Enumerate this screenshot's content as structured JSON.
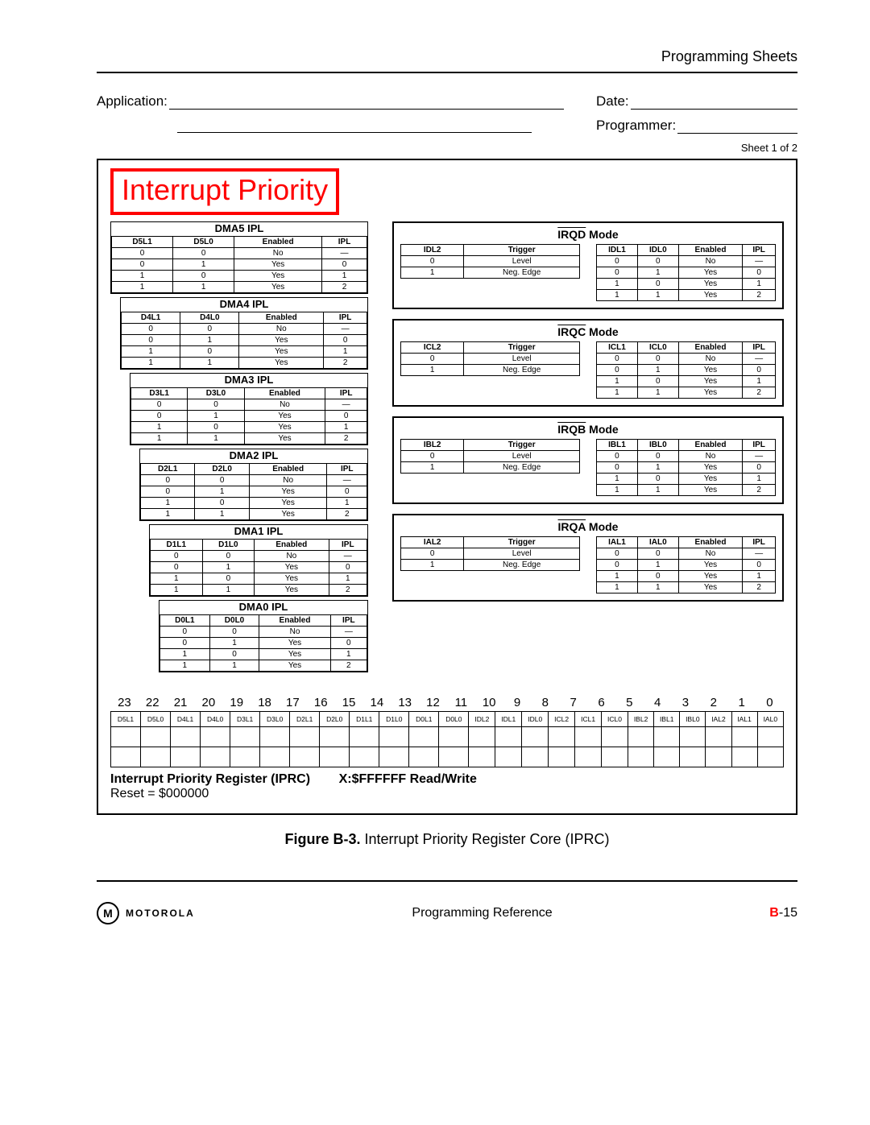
{
  "header": {
    "section": "Programming Sheets"
  },
  "form": {
    "application_label": "Application:",
    "date_label": "Date:",
    "programmer_label": "Programmer:",
    "sheet_info": "Sheet 1 of 2"
  },
  "title": "Interrupt Priority",
  "dma_tables": [
    {
      "caption": "DMA5 IPL",
      "headers": [
        "D5L1",
        "D5L0",
        "Enabled",
        "IPL"
      ],
      "rows": [
        [
          "0",
          "0",
          "No",
          "—"
        ],
        [
          "0",
          "1",
          "Yes",
          "0"
        ],
        [
          "1",
          "0",
          "Yes",
          "1"
        ],
        [
          "1",
          "1",
          "Yes",
          "2"
        ]
      ]
    },
    {
      "caption": "DMA4 IPL",
      "headers": [
        "D4L1",
        "D4L0",
        "Enabled",
        "IPL"
      ],
      "rows": [
        [
          "0",
          "0",
          "No",
          "—"
        ],
        [
          "0",
          "1",
          "Yes",
          "0"
        ],
        [
          "1",
          "0",
          "Yes",
          "1"
        ],
        [
          "1",
          "1",
          "Yes",
          "2"
        ]
      ]
    },
    {
      "caption": "DMA3 IPL",
      "headers": [
        "D3L1",
        "D3L0",
        "Enabled",
        "IPL"
      ],
      "rows": [
        [
          "0",
          "0",
          "No",
          "—"
        ],
        [
          "0",
          "1",
          "Yes",
          "0"
        ],
        [
          "1",
          "0",
          "Yes",
          "1"
        ],
        [
          "1",
          "1",
          "Yes",
          "2"
        ]
      ]
    },
    {
      "caption": "DMA2 IPL",
      "headers": [
        "D2L1",
        "D2L0",
        "Enabled",
        "IPL"
      ],
      "rows": [
        [
          "0",
          "0",
          "No",
          "—"
        ],
        [
          "0",
          "1",
          "Yes",
          "0"
        ],
        [
          "1",
          "0",
          "Yes",
          "1"
        ],
        [
          "1",
          "1",
          "Yes",
          "2"
        ]
      ]
    },
    {
      "caption": "DMA1 IPL",
      "headers": [
        "D1L1",
        "D1L0",
        "Enabled",
        "IPL"
      ],
      "rows": [
        [
          "0",
          "0",
          "No",
          "—"
        ],
        [
          "0",
          "1",
          "Yes",
          "0"
        ],
        [
          "1",
          "0",
          "Yes",
          "1"
        ],
        [
          "1",
          "1",
          "Yes",
          "2"
        ]
      ]
    },
    {
      "caption": "DMA0 IPL",
      "headers": [
        "D0L1",
        "D0L0",
        "Enabled",
        "IPL"
      ],
      "rows": [
        [
          "0",
          "0",
          "No",
          "—"
        ],
        [
          "0",
          "1",
          "Yes",
          "0"
        ],
        [
          "1",
          "0",
          "Yes",
          "1"
        ],
        [
          "1",
          "1",
          "Yes",
          "2"
        ]
      ]
    }
  ],
  "irq_modes": [
    {
      "title_bar": "IRQD",
      "title_suffix": " Mode",
      "trigger": {
        "headers": [
          "IDL2",
          "Trigger"
        ],
        "rows": [
          [
            "0",
            "Level"
          ],
          [
            "1",
            "Neg. Edge"
          ]
        ]
      },
      "ipl": {
        "headers": [
          "IDL1",
          "IDL0",
          "Enabled",
          "IPL"
        ],
        "rows": [
          [
            "0",
            "0",
            "No",
            "—"
          ],
          [
            "0",
            "1",
            "Yes",
            "0"
          ],
          [
            "1",
            "0",
            "Yes",
            "1"
          ],
          [
            "1",
            "1",
            "Yes",
            "2"
          ]
        ]
      }
    },
    {
      "title_bar": "IRQC",
      "title_suffix": " Mode",
      "trigger": {
        "headers": [
          "ICL2",
          "Trigger"
        ],
        "rows": [
          [
            "0",
            "Level"
          ],
          [
            "1",
            "Neg. Edge"
          ]
        ]
      },
      "ipl": {
        "headers": [
          "ICL1",
          "ICL0",
          "Enabled",
          "IPL"
        ],
        "rows": [
          [
            "0",
            "0",
            "No",
            "—"
          ],
          [
            "0",
            "1",
            "Yes",
            "0"
          ],
          [
            "1",
            "0",
            "Yes",
            "1"
          ],
          [
            "1",
            "1",
            "Yes",
            "2"
          ]
        ]
      }
    },
    {
      "title_bar": "IRQB",
      "title_suffix": " Mode",
      "trigger": {
        "headers": [
          "IBL2",
          "Trigger"
        ],
        "rows": [
          [
            "0",
            "Level"
          ],
          [
            "1",
            "Neg. Edge"
          ]
        ]
      },
      "ipl": {
        "headers": [
          "IBL1",
          "IBL0",
          "Enabled",
          "IPL"
        ],
        "rows": [
          [
            "0",
            "0",
            "No",
            "—"
          ],
          [
            "0",
            "1",
            "Yes",
            "0"
          ],
          [
            "1",
            "0",
            "Yes",
            "1"
          ],
          [
            "1",
            "1",
            "Yes",
            "2"
          ]
        ]
      }
    },
    {
      "title_bar": "IRQA",
      "title_suffix": " Mode",
      "trigger": {
        "headers": [
          "IAL2",
          "Trigger"
        ],
        "rows": [
          [
            "0",
            "Level"
          ],
          [
            "1",
            "Neg. Edge"
          ]
        ]
      },
      "ipl": {
        "headers": [
          "IAL1",
          "IAL0",
          "Enabled",
          "IPL"
        ],
        "rows": [
          [
            "0",
            "0",
            "No",
            "—"
          ],
          [
            "0",
            "1",
            "Yes",
            "0"
          ],
          [
            "1",
            "0",
            "Yes",
            "1"
          ],
          [
            "1",
            "1",
            "Yes",
            "2"
          ]
        ]
      }
    }
  ],
  "bit_numbers": [
    "23",
    "22",
    "21",
    "20",
    "19",
    "18",
    "17",
    "16",
    "15",
    "14",
    "13",
    "12",
    "11",
    "10",
    "9",
    "8",
    "7",
    "6",
    "5",
    "4",
    "3",
    "2",
    "1",
    "0"
  ],
  "bit_labels": [
    "D5L1",
    "D5L0",
    "D4L1",
    "D4L0",
    "D3L1",
    "D3L0",
    "D2L1",
    "D2L0",
    "D1L1",
    "D1L0",
    "D0L1",
    "D0L0",
    "IDL2",
    "IDL1",
    "IDL0",
    "ICL2",
    "ICL1",
    "ICL0",
    "IBL2",
    "IBL1",
    "IBL0",
    "IAL2",
    "IAL1",
    "IAL0"
  ],
  "register_info": {
    "name": "Interrupt Priority Register (IPRC)",
    "addr": "X:$FFFFFF Read/Write",
    "reset": "Reset = $000000"
  },
  "figure": {
    "label": "Figure B-3.",
    "caption": " Interrupt Priority Register Core (IPRC)"
  },
  "footer": {
    "brand": "MOTOROLA",
    "center": "Programming Reference",
    "page_prefix": "B",
    "page_suffix": "-15"
  }
}
